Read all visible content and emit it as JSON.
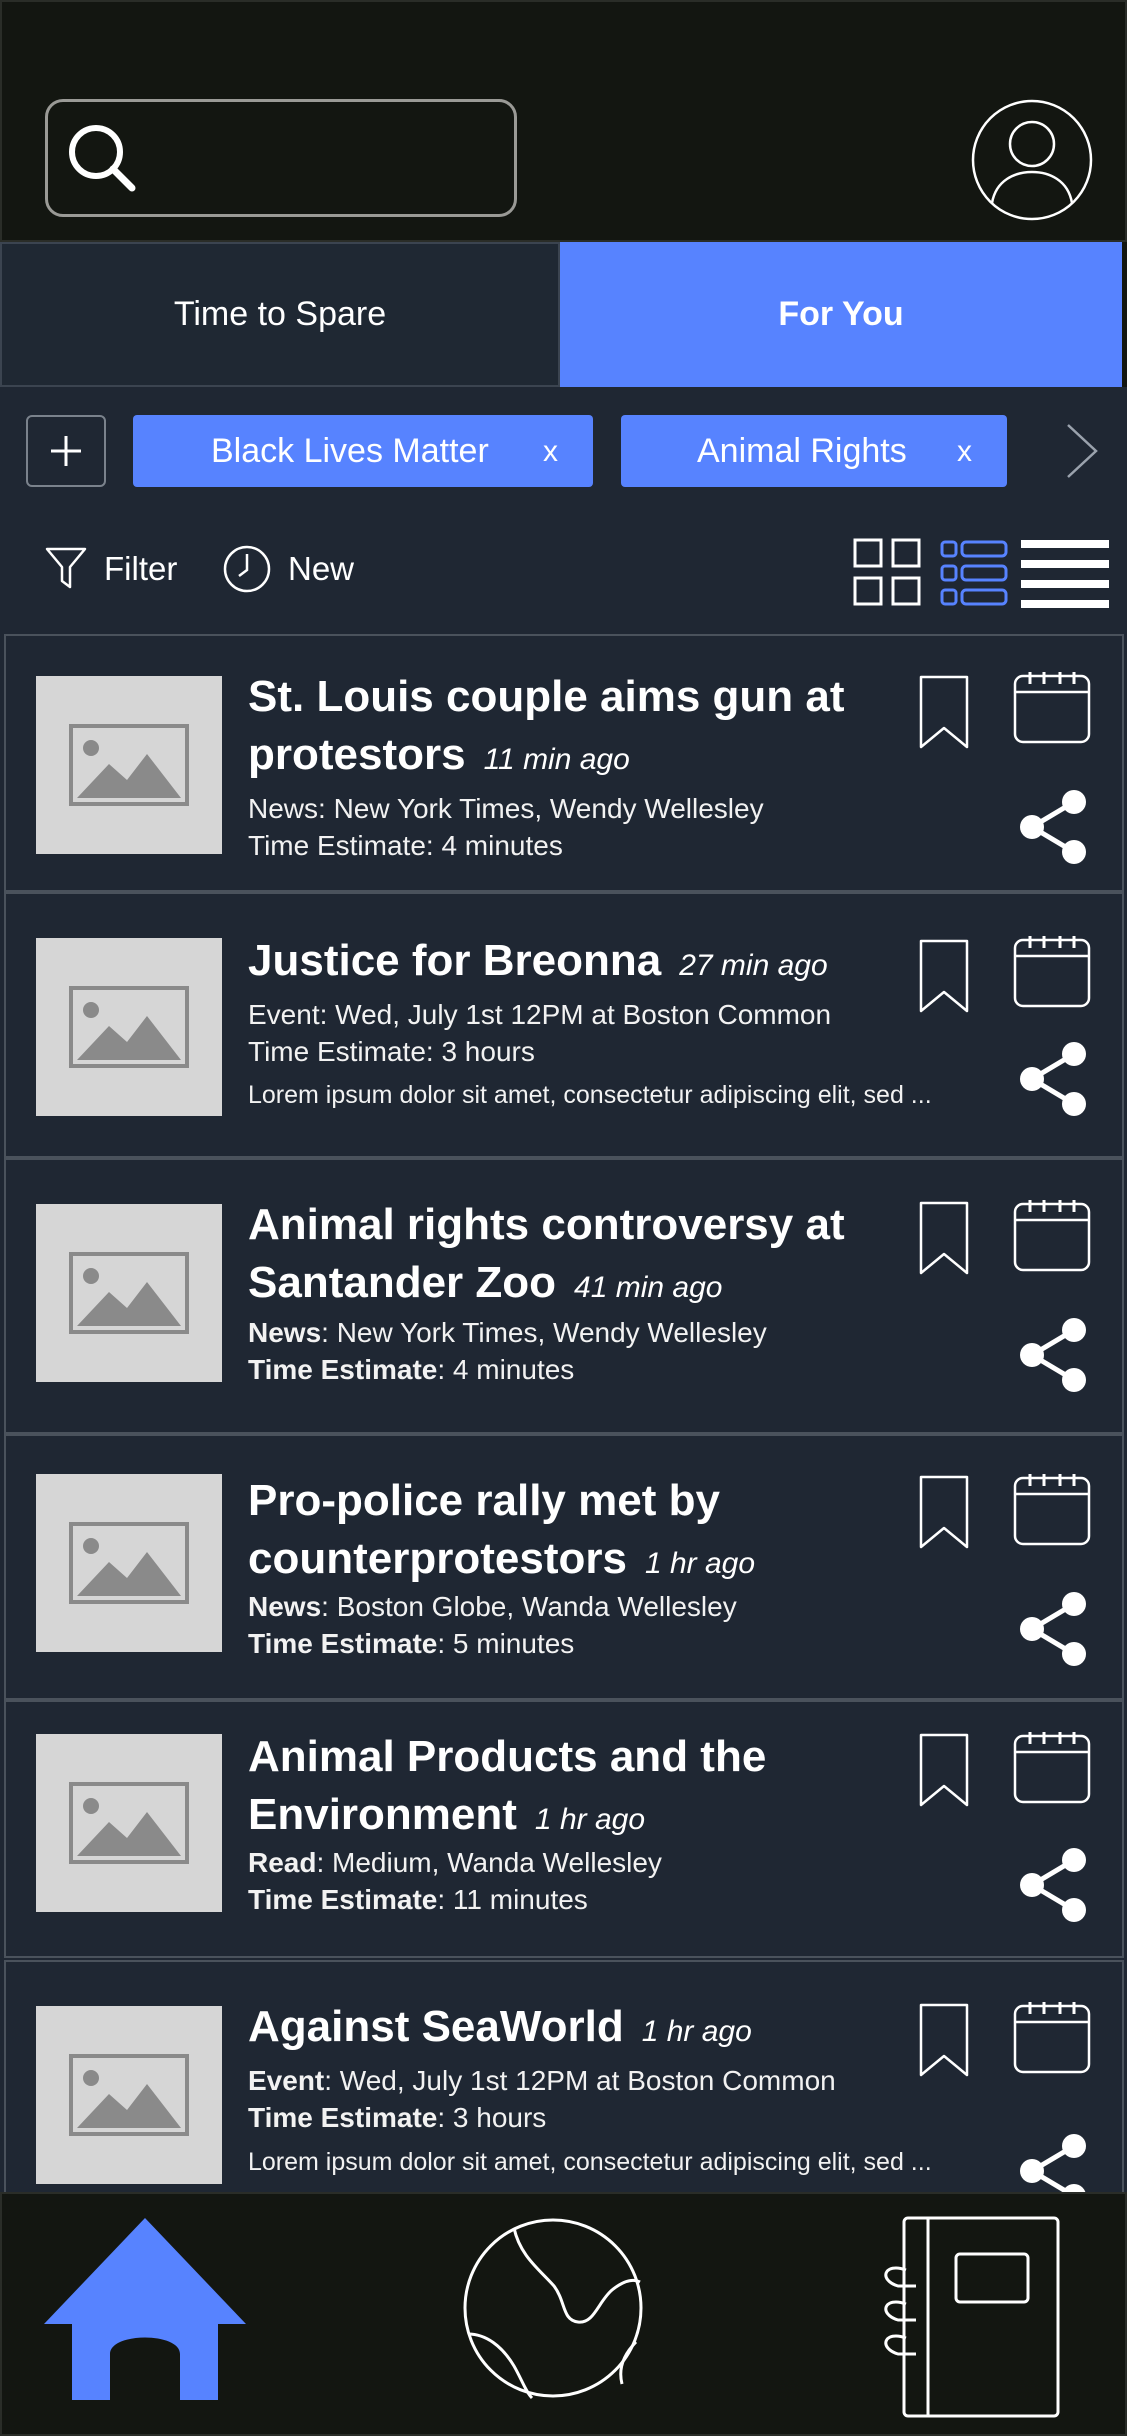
{
  "search": {
    "icon": "search-icon",
    "value": ""
  },
  "profile": {
    "icon": "user-profile-icon"
  },
  "tabs": [
    {
      "label": "Time to Spare",
      "active": false
    },
    {
      "label": "For You",
      "active": true
    }
  ],
  "chips": {
    "add_label": "+",
    "items": [
      {
        "label": "Black Lives Matter",
        "remove": "x"
      },
      {
        "label": "Animal Rights",
        "remove": "x"
      }
    ]
  },
  "toolbar": {
    "filter_label": "Filter",
    "new_label": "New",
    "views": [
      "grid-view-icon",
      "list-view-icon",
      "lines-view-icon"
    ],
    "active_view": "list-view-icon"
  },
  "cards": [
    {
      "title": "St. Louis couple aims gun at protestors",
      "time": "11 min ago",
      "line1_label": "",
      "line1": "News: New York Times, Wendy Wellesley",
      "line2_label": "",
      "line2": "Time Estimate: 4 minutes",
      "snippet": ""
    },
    {
      "title": "Justice for Breonna",
      "time": "27 min ago",
      "line1_label": "",
      "line1": "Event: Wed, July 1st 12PM at Boston Common",
      "line2_label": "",
      "line2": "Time Estimate: 3 hours",
      "snippet": "Lorem ipsum dolor sit amet, consectetur adipiscing elit, sed ..."
    },
    {
      "title": "Animal rights controversy at Santander Zoo",
      "time": "41 min ago",
      "line1_label": "News",
      "line1": ": New York Times, Wendy Wellesley",
      "line2_label": "Time Estimate",
      "line2": ": 4 minutes",
      "snippet": ""
    },
    {
      "title": "Pro-police rally met by counterprotestors",
      "time": "1 hr ago",
      "line1_label": "News",
      "line1": ": Boston Globe, Wanda Wellesley",
      "line2_label": "Time Estimate",
      "line2": ": 5 minutes",
      "snippet": ""
    },
    {
      "title": "Animal Products and the Environment",
      "time": "1 hr ago",
      "line1_label": "Read",
      "line1": ": Medium, Wanda Wellesley",
      "line2_label": "Time Estimate",
      "line2": ": 11 minutes",
      "snippet": ""
    },
    {
      "title": "Against SeaWorld",
      "time": "1 hr ago",
      "line1_label": "Event",
      "line1": ": Wed, July 1st 12PM at Boston Common",
      "line2_label": "Time Estimate",
      "line2": ": 3 hours",
      "snippet": "Lorem ipsum dolor sit amet, consectetur adipiscing elit, sed ..."
    }
  ],
  "bottom_nav": [
    {
      "icon": "home-icon",
      "active": true
    },
    {
      "icon": "globe-icon",
      "active": false
    },
    {
      "icon": "journal-icon",
      "active": false
    }
  ],
  "colors": {
    "accent": "#5783ff",
    "background": "#1f2733",
    "bar": "#131611",
    "placeholder": "#d6d6d6"
  }
}
